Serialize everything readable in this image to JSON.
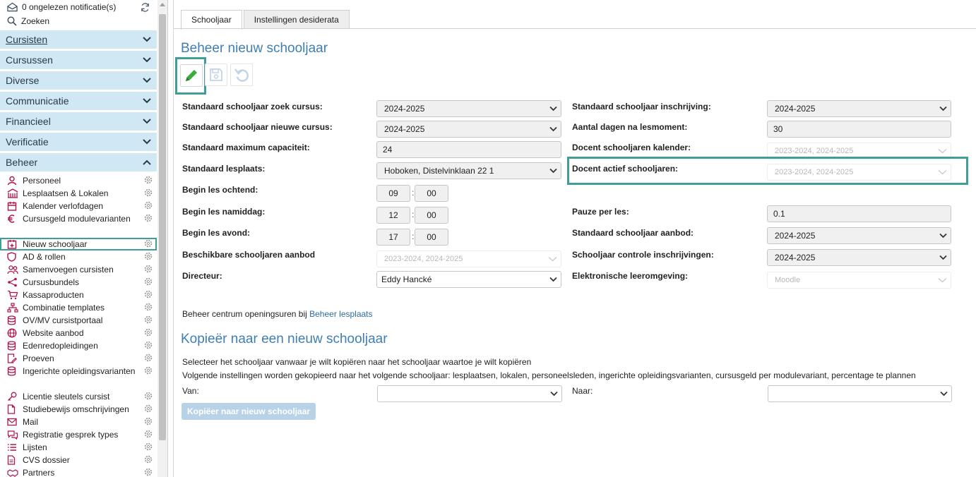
{
  "sidebar": {
    "notifications": "0 ongelezen notificatie(s)",
    "search_label": "Zoeken",
    "sections": [
      {
        "label": "Cursisten"
      },
      {
        "label": "Cursussen"
      },
      {
        "label": "Diverse"
      },
      {
        "label": "Communicatie"
      },
      {
        "label": "Financieel"
      },
      {
        "label": "Verificatie"
      },
      {
        "label": "Beheer"
      }
    ],
    "items": [
      {
        "label": "Personeel",
        "icon": "person-icon"
      },
      {
        "label": "Lesplaatsen & Lokalen",
        "icon": "building-icon"
      },
      {
        "label": "Kalender verlofdagen",
        "icon": "calendar-icon"
      },
      {
        "label": "Cursusgeld modulevarianten",
        "icon": "euro-icon"
      },
      {
        "label": "Nieuw schooljaar",
        "icon": "calendar-plus-icon"
      },
      {
        "label": "AD & rollen",
        "icon": "shield-icon"
      },
      {
        "label": "Samenvoegen cursisten",
        "icon": "users-icon"
      },
      {
        "label": "Cursusbundels",
        "icon": "nodes-icon"
      },
      {
        "label": "Kassaproducten",
        "icon": "cart-icon"
      },
      {
        "label": "Combinatie templates",
        "icon": "sitemap-icon"
      },
      {
        "label": "OV/MV cursistportaal",
        "icon": "database-icon"
      },
      {
        "label": "Website aanbod",
        "icon": "globe-icon"
      },
      {
        "label": "Edenredopleidingen",
        "icon": "database-icon"
      },
      {
        "label": "Proeven",
        "icon": "document-pen-icon"
      },
      {
        "label": "Ingerichte opleidingsvarianten",
        "icon": "database-icon"
      },
      {
        "label": "Licentie sleutels cursist",
        "icon": "key-icon"
      },
      {
        "label": "Studiebewijs omschrijvingen",
        "icon": "file-icon"
      },
      {
        "label": "Mail",
        "icon": "envelope-icon"
      },
      {
        "label": "Registratie gesprek types",
        "icon": "chat-icon"
      },
      {
        "label": "Lijsten",
        "icon": "list-icon"
      },
      {
        "label": "CVS dossier",
        "icon": "file-text-icon"
      },
      {
        "label": "Partners",
        "icon": "handshake-icon"
      }
    ]
  },
  "tabs": [
    {
      "label": "Schooljaar"
    },
    {
      "label": "Instellingen desiderata"
    }
  ],
  "page": {
    "title": "Beheer nieuw schooljaar",
    "copy_title": "Kopieër naar een nieuw schooljaar"
  },
  "form": {
    "left": {
      "zoek_label": "Standaard schooljaar zoek cursus:",
      "zoek_value": "2024-2025",
      "nieuw_label": "Standaard schooljaar nieuwe cursus:",
      "nieuw_value": "2024-2025",
      "cap_label": "Standaard maximum capaciteit:",
      "cap_value": "24",
      "lesplaats_label": "Standaard lesplaats:",
      "lesplaats_value": "Hoboken, Distelvinklaan 22 1",
      "ochtend_label": "Begin les ochtend:",
      "ochtend_h": "09",
      "ochtend_m": "00",
      "namiddag_label": "Begin les namiddag:",
      "namiddag_h": "12",
      "namiddag_m": "00",
      "avond_label": "Begin les avond:",
      "avond_h": "17",
      "avond_m": "00",
      "beschikbaar_label": "Beschikbare schooljaren aanbod",
      "beschikbaar_value": "2023-2024, 2024-2025",
      "directeur_label": "Directeur:",
      "directeur_value": "Eddy Hancké"
    },
    "right": {
      "inschrijving_label": "Standaard schooljaar inschrijving:",
      "inschrijving_value": "2024-2025",
      "dagen_label": "Aantal dagen na lesmoment:",
      "dagen_value": "30",
      "kalender_label": "Docent schooljaren kalender:",
      "kalender_value": "2023-2024, 2024-2025",
      "actief_label": "Docent actief schooljaren:",
      "actief_value": "2023-2024, 2024-2025",
      "pauze_label": "Pauze per les:",
      "pauze_value": "0.1",
      "aanbod_label": "Standaard schooljaar aanbod:",
      "aanbod_value": "2024-2025",
      "controle_label": "Schooljaar controle inschrijvingen:",
      "controle_value": "2024-2025",
      "elo_label": "Elektronische leeromgeving:",
      "elo_value": "Moodle"
    },
    "openingsuren_text": "Beheer centrum openingsuren bij",
    "openingsuren_link": "Beheer lesplaats"
  },
  "copy": {
    "line1": "Selecteer het schooljaar vanwaar je wilt kopiëren naar het schooljaar waartoe je wilt kopiëren",
    "line2": "Volgende instellingen worden gekopieerd naar het volgende schooljaar: lesplaatsen, lokalen, personeelsleden, ingerichte opleidingsvarianten, cursusgeld per modulevariant, percentage te plannen",
    "van_label": "Van:",
    "naar_label": "Naar:",
    "button_label": "Kopiëer naar nieuw schooljaar"
  },
  "colors": {
    "accent": "#3f9f97",
    "section_bg": "#cfe8f3",
    "heading": "#3f7eb3",
    "icon_red": "#b3124a"
  }
}
